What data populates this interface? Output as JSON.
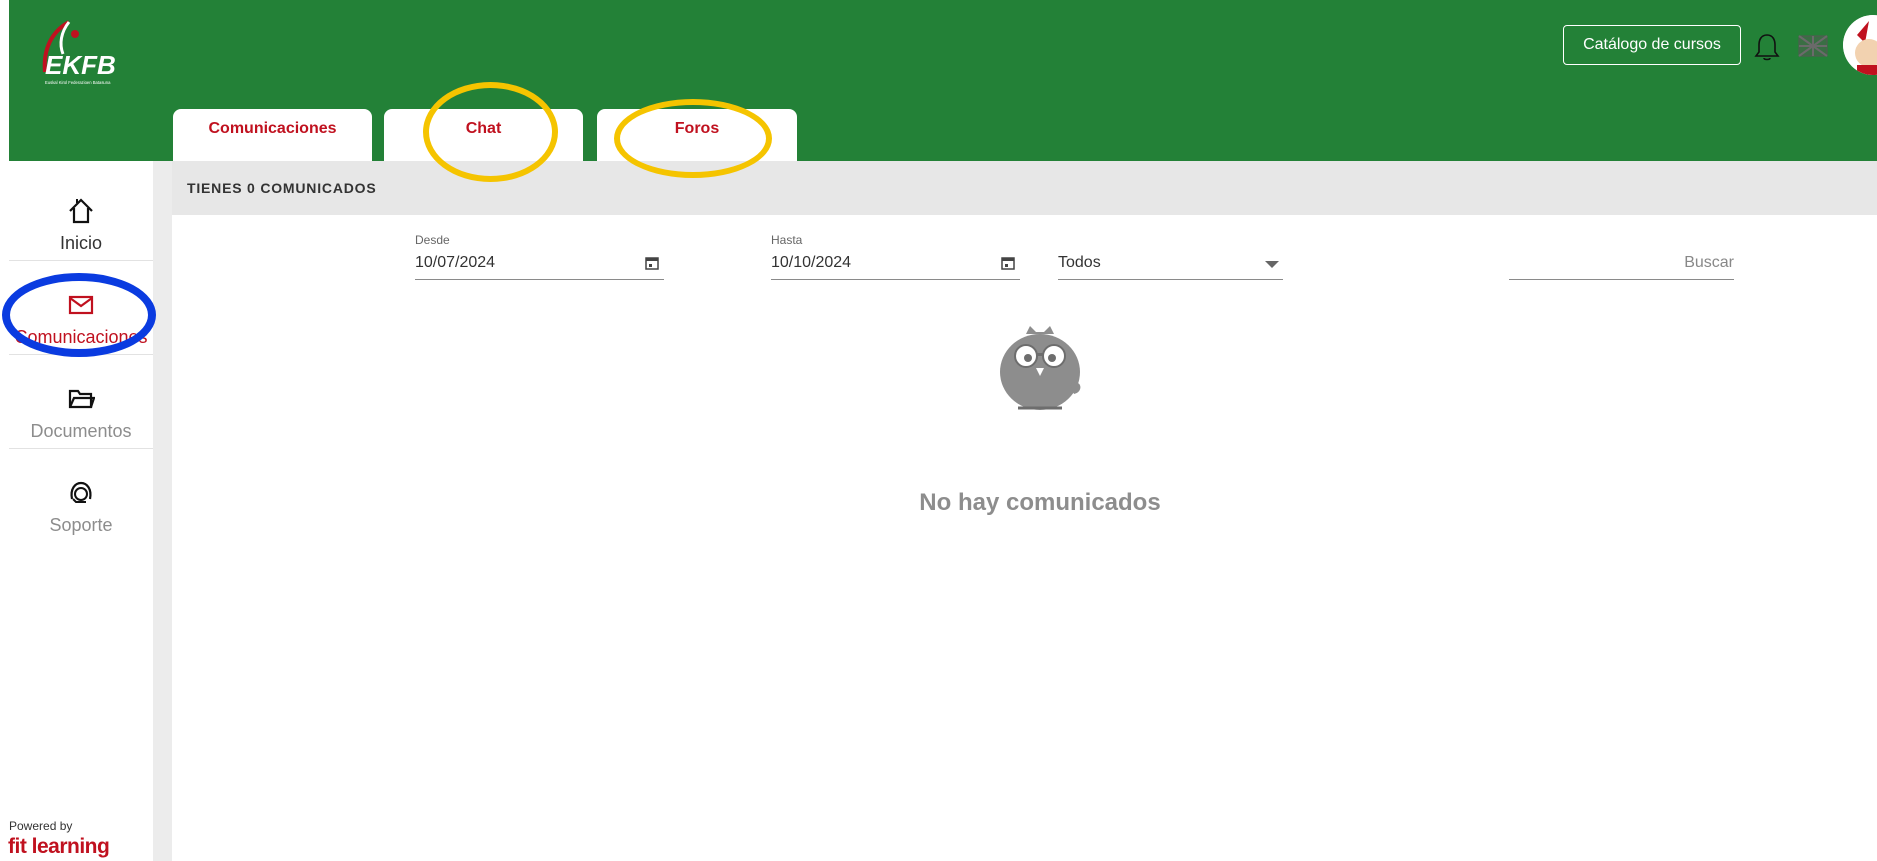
{
  "header": {
    "logo_text": "EKFB",
    "logo_subtext": "Euskal Kirol Federazioen Batasuna",
    "catalog_button": "Catálogo de cursos"
  },
  "tabs": [
    {
      "label": "Comunicaciones"
    },
    {
      "label": "Chat"
    },
    {
      "label": "Foros"
    }
  ],
  "sidebar": {
    "items": [
      {
        "label": "Inicio",
        "icon": "home-icon"
      },
      {
        "label": "Comunicaciones",
        "icon": "mail-icon",
        "active": true
      },
      {
        "label": "Documentos",
        "icon": "folder-icon"
      },
      {
        "label": "Soporte",
        "icon": "support-icon"
      }
    ],
    "powered_by": "Powered by",
    "brand": "fit learning"
  },
  "content": {
    "title": "TIENES 0 COMUNICADOS",
    "filters": {
      "from_label": "Desde",
      "from_value": "10/07/2024",
      "to_label": "Hasta",
      "to_value": "10/10/2024",
      "type_value": "Todos",
      "search_placeholder": "Buscar"
    },
    "empty_message": "No hay comunicados"
  },
  "colors": {
    "header_green": "#238137",
    "accent_red": "#c0111f",
    "annotation_yellow": "#f5c400",
    "annotation_blue": "#0a3be0"
  }
}
